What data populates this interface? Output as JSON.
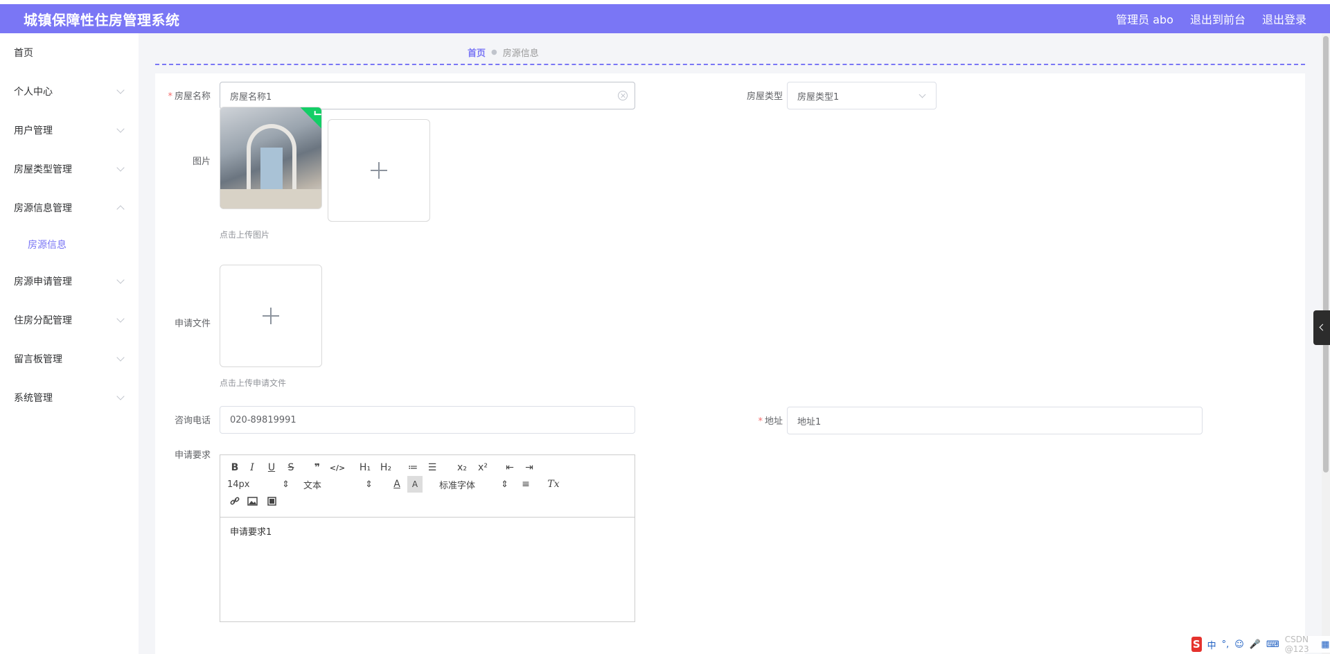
{
  "header": {
    "title": "城镇保障性住房管理系统",
    "admin": "管理员 abo",
    "to_front": "退出到前台",
    "logout": "退出登录"
  },
  "sidebar": {
    "items": [
      {
        "label": "首页"
      },
      {
        "label": "个人中心"
      },
      {
        "label": "用户管理"
      },
      {
        "label": "房屋类型管理"
      },
      {
        "label": "房源信息管理"
      },
      {
        "label": "房源申请管理"
      },
      {
        "label": "住房分配管理"
      },
      {
        "label": "留言板管理"
      },
      {
        "label": "系统管理"
      }
    ],
    "sub_active": "房源信息"
  },
  "breadcrumb": {
    "home": "首页",
    "current": "房源信息"
  },
  "form": {
    "house_name_label": "房屋名称",
    "house_name_value": "房屋名称1",
    "house_type_label": "房屋类型",
    "house_type_value": "房屋类型1",
    "image_label": "图片",
    "image_tip": "点击上传图片",
    "file_label": "申请文件",
    "file_tip": "点击上传申请文件",
    "phone_label": "咨询电话",
    "phone_value": "020-89819991",
    "address_label": "地址",
    "address_value": "地址1",
    "requirement_label": "申请要求",
    "requirement_value": "申请要求1"
  },
  "editor": {
    "bold": "B",
    "italic": "I",
    "underline": "U",
    "strike": "S",
    "quote": "❞",
    "code": "</>",
    "h1": "H₁",
    "h2": "H₂",
    "ordered_list": "≔",
    "bullet_list": "☰",
    "subscript": "x₂",
    "superscript": "x²",
    "outdent": "⇤",
    "indent": "⇥",
    "size": "14px",
    "format": "文本",
    "font": "标准字体",
    "color": "A",
    "background": "A",
    "align": "≡",
    "clear": "Tx"
  },
  "ime": {
    "logo": "S",
    "lang": "中",
    "punct": "°,",
    "watermark": "CSDN @123"
  }
}
